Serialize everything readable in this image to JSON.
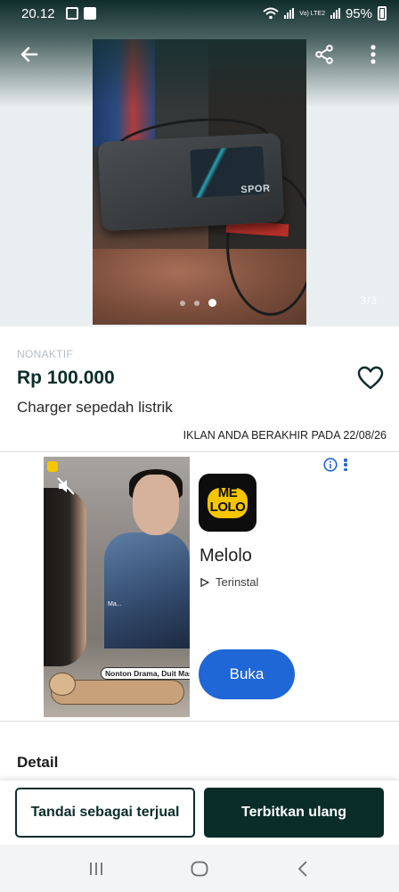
{
  "status_bar": {
    "time": "20.12",
    "lte_label": "Vo) LTE2",
    "battery": "95%"
  },
  "gallery": {
    "counter": "3/3",
    "current_index": 3,
    "total": 3,
    "photo_brand": "SPOR"
  },
  "listing": {
    "status_label": "NONAKTIF",
    "price": "Rp 100.000",
    "title": "Charger sepedah listrik",
    "expiry_text": "IKLAN ANDA BERAKHIR PADA 22/08/26"
  },
  "ad": {
    "app_name": "Melolo",
    "app_icon_text": "ME\nLOLO",
    "installed_label": "Terinstal",
    "cta_label": "Buka",
    "sticker_text": "Nonton Drama, Duit Masuk!",
    "video_overlay_text": "Ma..."
  },
  "section": {
    "detail_heading": "Detail"
  },
  "actions": {
    "mark_sold_label": "Tandai sebagai terjual",
    "republish_label": "Terbitkan ulang"
  },
  "icons": {
    "back": "arrow-left-icon",
    "share": "share-icon",
    "more": "more-vertical-icon",
    "favorite": "heart-icon",
    "ad_info": "info-icon",
    "nav_recents": "recents-icon",
    "nav_home": "home-icon",
    "nav_back": "chevron-left-icon"
  },
  "colors": {
    "primary_dark": "#0b2d2a",
    "ad_cta_blue": "#1f66d6",
    "inactive_label": "#b4bcc0"
  }
}
